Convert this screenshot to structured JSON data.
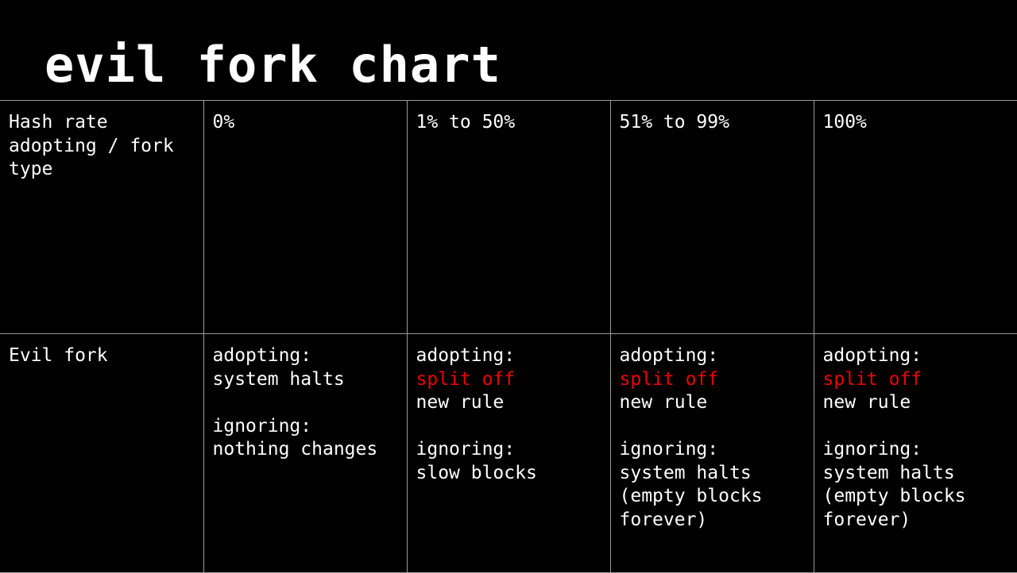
{
  "title": "evil fork chart",
  "colors": {
    "background": "#000000",
    "text": "#ffffff",
    "highlight": "#ee0000",
    "grid": "#9a9a9a"
  },
  "table": {
    "header": {
      "row_label": "Hash rate adopting / fork type",
      "columns": [
        "0%",
        "1% to 50%",
        "51% to 99%",
        "100%"
      ]
    },
    "evil_fork": {
      "row_label": "Evil fork",
      "cells": [
        {
          "adopting_label": "adopting:",
          "adopting_result": "system halts",
          "ignoring_label": "ignoring:",
          "ignoring_result": "nothing changes"
        },
        {
          "adopting_label": "adopting:",
          "adopting_result": "split off",
          "adopting_note": "new rule",
          "ignoring_label": "ignoring:",
          "ignoring_result": "slow blocks"
        },
        {
          "adopting_label": "adopting:",
          "adopting_result": "split off",
          "adopting_note": "new rule",
          "ignoring_label": "ignoring:",
          "ignoring_result": "system halts",
          "ignoring_note_1": "(empty blocks",
          "ignoring_note_2": "forever)"
        },
        {
          "adopting_label": "adopting:",
          "adopting_result": "split off",
          "adopting_note": "new rule",
          "ignoring_label": "ignoring:",
          "ignoring_result": "system halts",
          "ignoring_note_1": "(empty blocks",
          "ignoring_note_2": "forever)"
        }
      ]
    }
  }
}
